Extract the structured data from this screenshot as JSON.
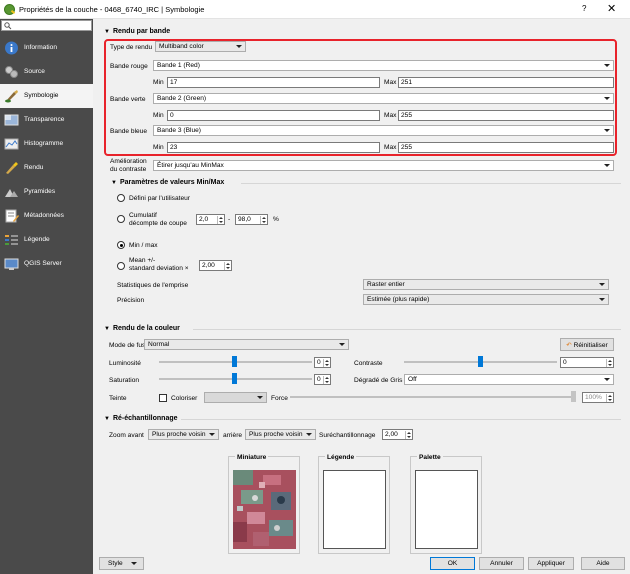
{
  "window": {
    "title": "Propriétés de la couche - 0468_6740_IRC | Symbologie",
    "help": "?",
    "close": "✕"
  },
  "sidebar": {
    "search_placeholder": "",
    "items": [
      {
        "label": "Information",
        "icon": "info-icon"
      },
      {
        "label": "Source",
        "icon": "source-icon"
      },
      {
        "label": "Symbologie",
        "icon": "symbology-icon"
      },
      {
        "label": "Transparence",
        "icon": "transparency-icon"
      },
      {
        "label": "Histogramme",
        "icon": "histogram-icon"
      },
      {
        "label": "Rendu",
        "icon": "rendering-icon"
      },
      {
        "label": "Pyramides",
        "icon": "pyramids-icon"
      },
      {
        "label": "Métadonnées",
        "icon": "metadata-icon"
      },
      {
        "label": "Légende",
        "icon": "legend-icon"
      },
      {
        "label": "QGIS Server",
        "icon": "qgis-server-icon"
      }
    ],
    "active_index": 2
  },
  "band": {
    "section": "Rendu par bande",
    "render_type_label": "Type de rendu",
    "render_type": "Multiband color",
    "red_label": "Bande rouge",
    "red_value": "Bande 1 (Red)",
    "green_label": "Bande verte",
    "green_value": "Bande 2 (Green)",
    "blue_label": "Bande bleue",
    "blue_value": "Bande 3 (Blue)",
    "min_label": "Min",
    "max_label": "Max",
    "red_min": "17",
    "red_max": "251",
    "green_min": "0",
    "green_max": "255",
    "blue_min": "23",
    "blue_max": "255",
    "contrast_label_1": "Amélioration",
    "contrast_label_2": "du contraste",
    "contrast_value": "Étirer jusqu'au MinMax"
  },
  "minmax": {
    "section": "Paramètres de valeurs Min/Max",
    "user_defined": "Défini par l'utilisateur",
    "cumulative_1": "Cumulatif",
    "cumulative_2": "décompte de coupe",
    "cum_low": "2,0",
    "cum_sep": "-",
    "cum_high": "98,0",
    "cum_unit": "%",
    "minmax_label": "Min / max",
    "mean_1": "Mean +/-",
    "mean_2": "standard deviation ×",
    "mean_value": "2,00",
    "extent_label": "Statistiques de l'emprise",
    "extent_value": "Raster entier",
    "precision_label": "Précision",
    "precision_value": "Estimée (plus rapide)"
  },
  "color": {
    "section": "Rendu de la couleur",
    "blend_label": "Mode de fusion",
    "blend_value": "Normal",
    "reset_label": "Réinitialiser",
    "brightness_label": "Luminosité",
    "brightness_value": "0",
    "contrast_label": "Contraste",
    "contrast_value": "0",
    "saturation_label": "Saturation",
    "saturation_value": "0",
    "grayscale_label": "Dégradé de Gris",
    "grayscale_value": "Off",
    "hue_label": "Teinte",
    "colorize_label": "Coloriser",
    "force_label": "Force",
    "force_value": "100%"
  },
  "resample": {
    "section": "Ré-échantillonnage",
    "zoom_in_label": "Zoom avant",
    "zoom_in_value": "Plus proche voisin",
    "zoom_out_label": "arrière",
    "zoom_out_value": "Plus proche voisin",
    "oversample_label": "Suréchantillonnage",
    "oversample_value": "2,00"
  },
  "previews": {
    "thumbnail": "Miniature",
    "legend": "Légende",
    "palette": "Palette"
  },
  "footer": {
    "style": "Style",
    "ok": "OK",
    "cancel": "Annuler",
    "apply": "Appliquer",
    "help": "Aide"
  },
  "colors": {
    "sidebar_bg": "#4a4a4a",
    "highlight": "#e8232b",
    "accent": "#0078d7"
  }
}
